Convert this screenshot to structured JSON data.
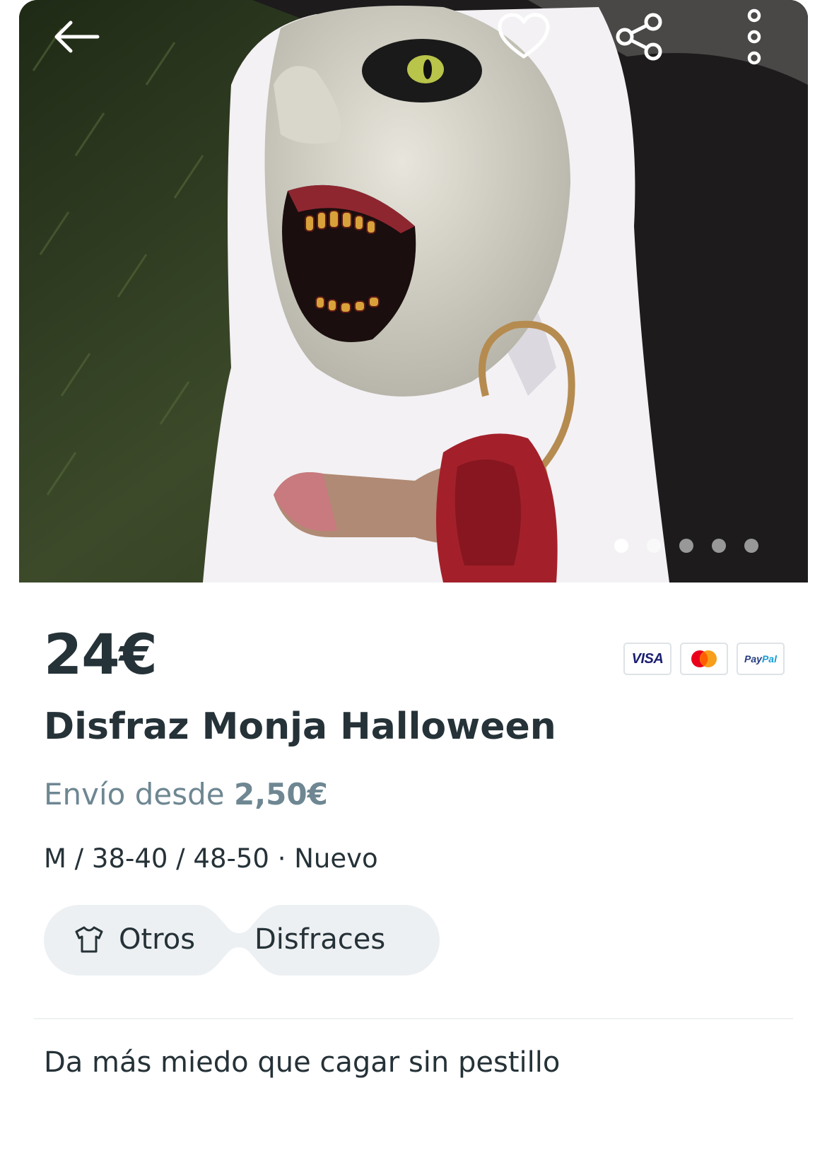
{
  "header": {
    "back_icon": "arrow-left-icon",
    "favorite_icon": "heart-icon",
    "share_icon": "share-icon",
    "more_icon": "more-vertical-icon"
  },
  "gallery": {
    "photo_count": 5,
    "active_index": 0
  },
  "product": {
    "price": "24€",
    "title": "Disfraz Monja Halloween",
    "shipping_prefix": "Envío desde",
    "shipping_price": "2,50€",
    "attributes": "M / 38-40 / 48-50 · Nuevo",
    "description": "Da más miedo que cagar sin pestillo"
  },
  "payments": {
    "visa": "VISA",
    "paypal_a": "Pay",
    "paypal_b": "Pal"
  },
  "categories": [
    {
      "label": "Otros",
      "icon": "tshirt-icon"
    },
    {
      "label": "Disfraces"
    }
  ],
  "colors": {
    "text_primary": "#253238",
    "text_secondary": "#6e8792",
    "chip_background": "#edf0f2",
    "divider": "#eef1f2"
  }
}
